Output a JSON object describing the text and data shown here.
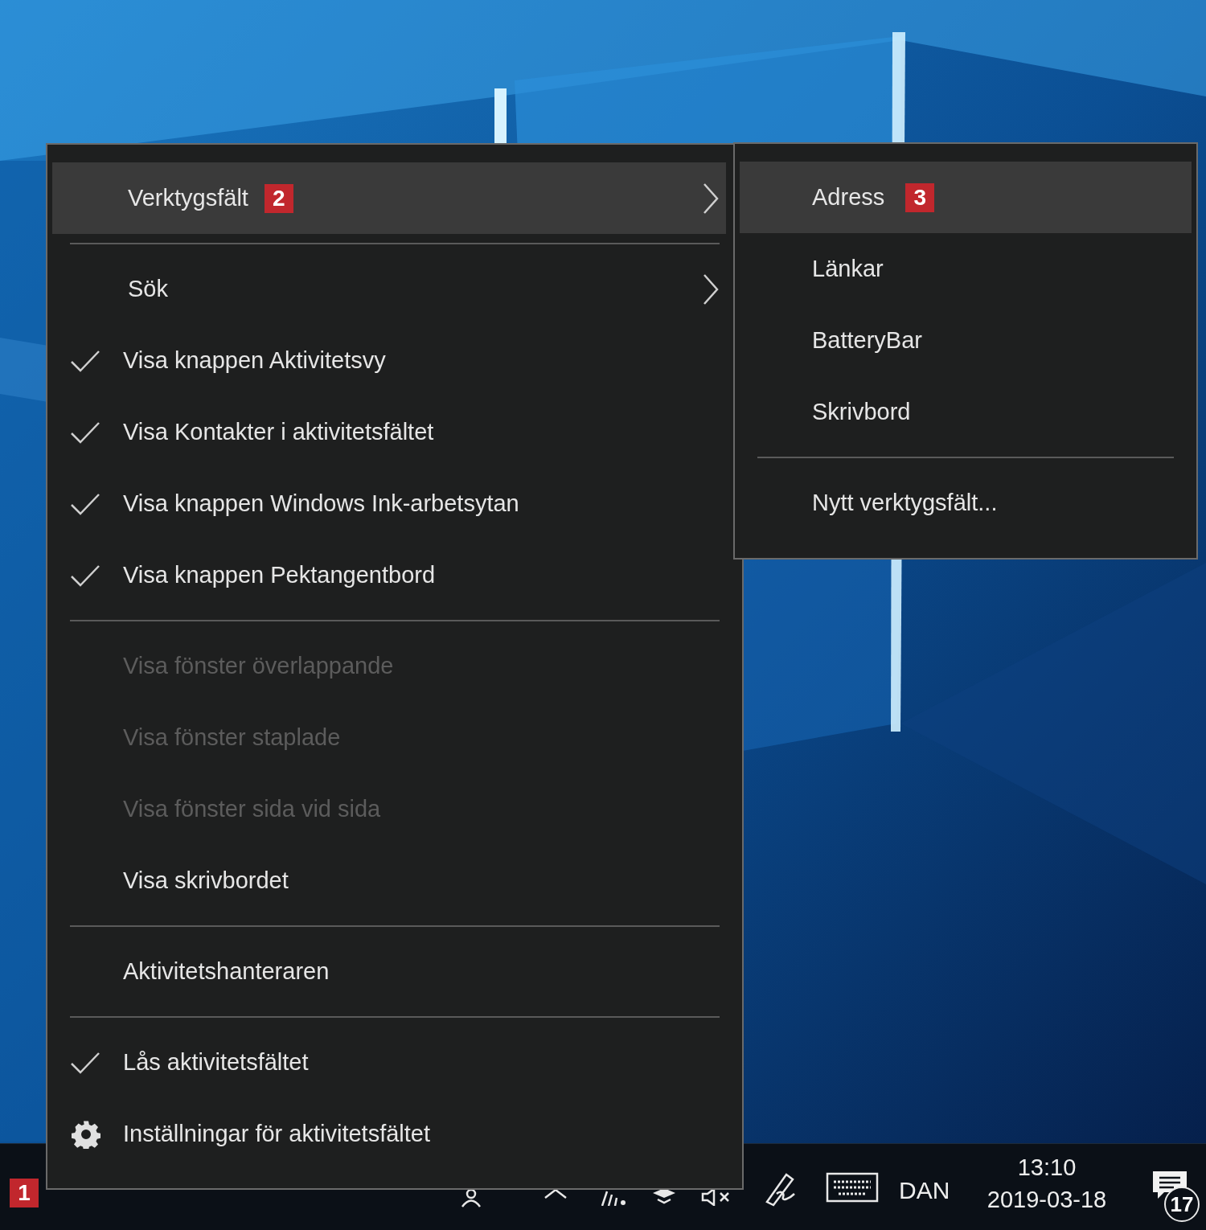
{
  "menu": {
    "items": [
      {
        "kind": "submenu",
        "label": "Verktygsfält",
        "badge": "2",
        "selected": true
      },
      {
        "kind": "separator"
      },
      {
        "kind": "submenu",
        "label": "Sök",
        "selected": false
      },
      {
        "kind": "check",
        "label": "Visa knappen Aktivitetsvy",
        "checked": true,
        "disabled": false
      },
      {
        "kind": "check",
        "label": "Visa Kontakter i aktivitetsfältet",
        "checked": true,
        "disabled": false
      },
      {
        "kind": "check",
        "label": "Visa knappen Windows Ink-arbetsytan",
        "checked": true,
        "disabled": false
      },
      {
        "kind": "check",
        "label": "Visa knappen Pektangentbord",
        "checked": true,
        "disabled": false
      },
      {
        "kind": "separator"
      },
      {
        "kind": "check",
        "label": "Visa fönster överlappande",
        "checked": false,
        "disabled": true
      },
      {
        "kind": "check",
        "label": "Visa fönster staplade",
        "checked": false,
        "disabled": true
      },
      {
        "kind": "check",
        "label": "Visa fönster sida vid sida",
        "checked": false,
        "disabled": true
      },
      {
        "kind": "check",
        "label": "Visa skrivbordet",
        "checked": false,
        "disabled": false
      },
      {
        "kind": "separator"
      },
      {
        "kind": "check",
        "label": "Aktivitetshanteraren",
        "checked": false,
        "disabled": false
      },
      {
        "kind": "separator"
      },
      {
        "kind": "check",
        "label": "Lås aktivitetsfältet",
        "checked": true,
        "disabled": false
      },
      {
        "kind": "settings",
        "label": "Inställningar för aktivitetsfältet"
      }
    ]
  },
  "submenu": {
    "items": [
      {
        "kind": "item",
        "label": "Adress",
        "badge": "3",
        "selected": true
      },
      {
        "kind": "item",
        "label": "Länkar",
        "selected": false
      },
      {
        "kind": "item",
        "label": "BatteryBar",
        "selected": false
      },
      {
        "kind": "item",
        "label": "Skrivbord",
        "selected": false
      },
      {
        "kind": "separator"
      },
      {
        "kind": "item",
        "label": "Nytt verktygsfält...",
        "selected": false
      }
    ]
  },
  "taskbar": {
    "badge": "1",
    "language": "DAN",
    "time": "13:10",
    "date": "2019-03-18",
    "notification_count": "17"
  }
}
